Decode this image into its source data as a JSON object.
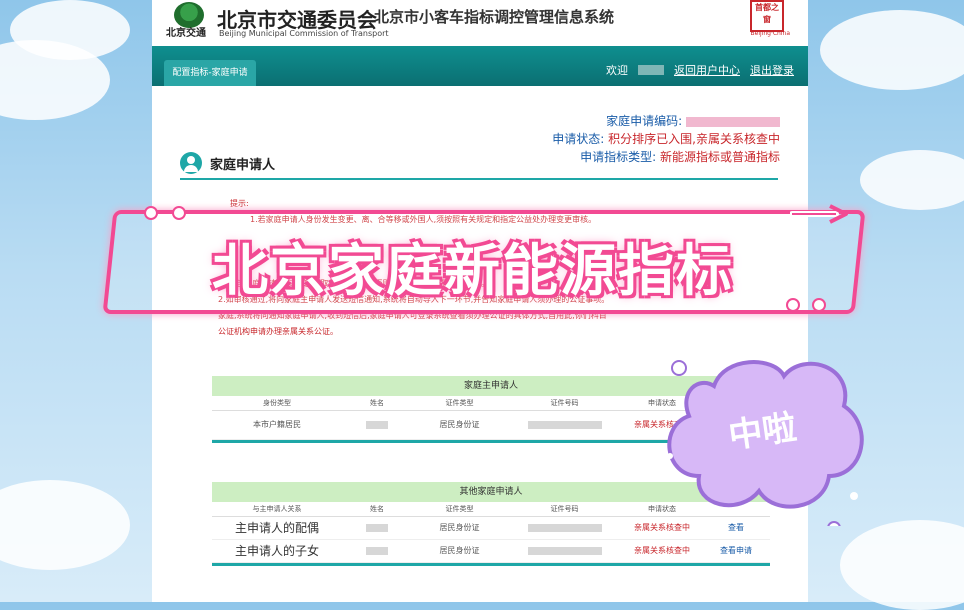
{
  "header": {
    "logo_text": "北京交通",
    "org_name": "北京市交通委员会",
    "org_name_en": "Beijing Municipal Commission of Transport",
    "system_name": "北京市小客车指标调控管理信息系统",
    "seal_text": "首都之窗",
    "seal_sub": "Beijing·China"
  },
  "nav": {
    "tab_label": "配置指标-家庭申请",
    "welcome": "欢迎",
    "user_center": "返回用户中心",
    "logout": "退出登录"
  },
  "meta": {
    "code_label": "家庭申请编码:",
    "status_label": "申请状态:",
    "status_value": "积分排序已入围,亲属关系核查中",
    "type_label": "申请指标类型:",
    "type_value": "新能源指标或普通指标"
  },
  "section": {
    "title": "家庭申请人"
  },
  "notice": {
    "title": "提示:",
    "line1": "1.若家庭申请人身份发生变更、离、合等移或外国人,须按照有关规定和指定公益处办理变更审核。",
    "line2": "合理定,家庭申请状态将变为\"取得家庭编码\",否则,将需要办理亲属关系公证。",
    "line3": "2.如审核通过,将向家庭主申请人发送短信通知,系统将自动导入下一环节,并告知家庭申请人须办理的公证事项。",
    "line4": "家庭,系统将向通知家庭申请人,收到短信后,家庭申请人可登录系统查看须办理公证的具体方式,自用此,你们科目",
    "line5": "公证机构申请办理亲属关系公证。"
  },
  "main_table": {
    "title": "家庭主申请人",
    "columns": [
      "身份类型",
      "姓名",
      "证件类型",
      "证件号码",
      "申请状态",
      ""
    ],
    "rows": [
      {
        "identity": "本市户籍居民",
        "doc_type": "居民身份证",
        "status": "亲属关系核查中"
      }
    ]
  },
  "other_table": {
    "title": "其他家庭申请人",
    "columns": [
      "与主申请人关系",
      "姓名",
      "证件类型",
      "证件号码",
      "申请状态",
      ""
    ],
    "rows": [
      {
        "relation": "主申请人的配偶",
        "doc_type": "居民身份证",
        "status": "亲属关系核查中",
        "action": "查看"
      },
      {
        "relation": "主申请人的子女",
        "doc_type": "居民身份证",
        "status": "亲属关系核查中",
        "action": "查看申请"
      }
    ]
  },
  "overlay": {
    "banner_text": "北京家庭新能源指标",
    "sticker_text": "中啦"
  },
  "colors": {
    "teal": "#0b6f72",
    "accent_red": "#c8262b",
    "link_blue": "#1a5ca8",
    "banner_pink": "#f24a93",
    "sticker_purple": "#c9a8f0"
  }
}
